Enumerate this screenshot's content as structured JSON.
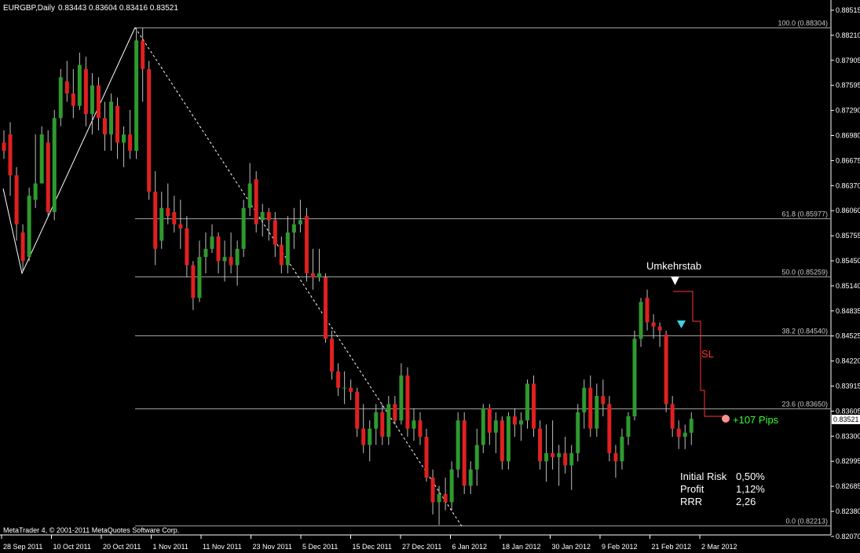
{
  "header": {
    "symbol": "EURGBP,Daily",
    "ohlc": "0.83443 0.83604 0.83416 0.83521"
  },
  "price_axis": {
    "ticks": [
      "0.88515",
      "0.88210",
      "0.87905",
      "0.87595",
      "0.87290",
      "0.86980",
      "0.86675",
      "0.86370",
      "0.86060",
      "0.85755",
      "0.85450",
      "0.85140",
      "0.84835",
      "0.84525",
      "0.84220",
      "0.83915",
      "0.83605",
      "0.83300",
      "0.82995",
      "0.82685",
      "0.82380",
      "0.82070"
    ],
    "current_price": "0.83521"
  },
  "time_axis": {
    "labels": [
      "28 Sep 2011",
      "10 Oct 2011",
      "20 Oct 2011",
      "1 Nov 2011",
      "11 Nov 2011",
      "23 Nov 2011",
      "5 Dec 2011",
      "15 Dec 2011",
      "27 Dec 2011",
      "6 Jan 2012",
      "18 Jan 2012",
      "30 Jan 2012",
      "9 Feb 2012",
      "21 Feb 2012",
      "2 Mar 2012"
    ]
  },
  "fibonacci": [
    {
      "label": "100.0 (0.88304)",
      "price": 0.88304
    },
    {
      "label": "61.8 (0.85977)",
      "price": 0.85977
    },
    {
      "label": "50.0 (0.85259)",
      "price": 0.85259
    },
    {
      "label": "38.2 (0.84540)",
      "price": 0.8454
    },
    {
      "label": "23.6 (0.83650)",
      "price": 0.8365
    },
    {
      "label": "0.0 (0.82213)",
      "price": 0.82213
    }
  ],
  "annotations": {
    "signal_label": "Umkehrstab",
    "sl_label": "SL",
    "profit_label": "+107 Pips"
  },
  "stats": [
    {
      "label": "Initial Risk",
      "value": "0,50%"
    },
    {
      "label": "Profit",
      "value": "1,12%"
    },
    {
      "label": "RRR",
      "value": "2,26"
    }
  ],
  "footer": {
    "copyright": "MetaTrader 4, © 2001-2011 MetaQuotes Software Corp."
  },
  "colors": {
    "background": "#000000",
    "bull": "#2e9a2e",
    "bear": "#e02020",
    "wick": "#c0c0c0",
    "fib_line": "#a0a0a0",
    "marker": "#ffffff",
    "entry_marker": "#40d0e0",
    "profit_marker": "#ff9090",
    "profit_text": "#33ff33",
    "sl": "#ff3333"
  },
  "chart_data": {
    "type": "candlestick",
    "symbol": "EURGBP",
    "timeframe": "Daily",
    "ylim": [
      0.8207,
      0.8852
    ],
    "candles": [
      {
        "o": 0.869,
        "h": 0.8705,
        "l": 0.867,
        "c": 0.868
      },
      {
        "o": 0.87,
        "h": 0.8715,
        "l": 0.8625,
        "c": 0.865
      },
      {
        "o": 0.865,
        "h": 0.866,
        "l": 0.857,
        "c": 0.859
      },
      {
        "o": 0.858,
        "h": 0.859,
        "l": 0.8532,
        "c": 0.8545
      },
      {
        "o": 0.855,
        "h": 0.8635,
        "l": 0.8545,
        "c": 0.8625
      },
      {
        "o": 0.862,
        "h": 0.87,
        "l": 0.861,
        "c": 0.864
      },
      {
        "o": 0.864,
        "h": 0.871,
        "l": 0.864,
        "c": 0.87
      },
      {
        "o": 0.869,
        "h": 0.8705,
        "l": 0.86,
        "c": 0.8605
      },
      {
        "o": 0.8605,
        "h": 0.873,
        "l": 0.8595,
        "c": 0.872
      },
      {
        "o": 0.872,
        "h": 0.878,
        "l": 0.871,
        "c": 0.877
      },
      {
        "o": 0.8765,
        "h": 0.879,
        "l": 0.874,
        "c": 0.875
      },
      {
        "o": 0.875,
        "h": 0.878,
        "l": 0.872,
        "c": 0.8735
      },
      {
        "o": 0.8735,
        "h": 0.88,
        "l": 0.873,
        "c": 0.8785
      },
      {
        "o": 0.878,
        "h": 0.8795,
        "l": 0.871,
        "c": 0.8725
      },
      {
        "o": 0.8725,
        "h": 0.8775,
        "l": 0.87,
        "c": 0.876
      },
      {
        "o": 0.876,
        "h": 0.877,
        "l": 0.8705,
        "c": 0.872
      },
      {
        "o": 0.872,
        "h": 0.874,
        "l": 0.868,
        "c": 0.87
      },
      {
        "o": 0.87,
        "h": 0.875,
        "l": 0.868,
        "c": 0.874
      },
      {
        "o": 0.8735,
        "h": 0.8745,
        "l": 0.867,
        "c": 0.869
      },
      {
        "o": 0.869,
        "h": 0.871,
        "l": 0.866,
        "c": 0.87
      },
      {
        "o": 0.87,
        "h": 0.873,
        "l": 0.867,
        "c": 0.868
      },
      {
        "o": 0.868,
        "h": 0.883,
        "l": 0.867,
        "c": 0.8815
      },
      {
        "o": 0.8815,
        "h": 0.883,
        "l": 0.874,
        "c": 0.878
      },
      {
        "o": 0.878,
        "h": 0.879,
        "l": 0.862,
        "c": 0.863
      },
      {
        "o": 0.863,
        "h": 0.8655,
        "l": 0.854,
        "c": 0.856
      },
      {
        "o": 0.857,
        "h": 0.863,
        "l": 0.856,
        "c": 0.861
      },
      {
        "o": 0.861,
        "h": 0.864,
        "l": 0.859,
        "c": 0.86
      },
      {
        "o": 0.8605,
        "h": 0.8625,
        "l": 0.858,
        "c": 0.859
      },
      {
        "o": 0.859,
        "h": 0.862,
        "l": 0.856,
        "c": 0.8585
      },
      {
        "o": 0.8585,
        "h": 0.86,
        "l": 0.8525,
        "c": 0.854
      },
      {
        "o": 0.854,
        "h": 0.8545,
        "l": 0.8485,
        "c": 0.85
      },
      {
        "o": 0.85,
        "h": 0.857,
        "l": 0.8495,
        "c": 0.855
      },
      {
        "o": 0.855,
        "h": 0.858,
        "l": 0.853,
        "c": 0.856
      },
      {
        "o": 0.856,
        "h": 0.859,
        "l": 0.8555,
        "c": 0.8575
      },
      {
        "o": 0.8575,
        "h": 0.858,
        "l": 0.853,
        "c": 0.8545
      },
      {
        "o": 0.8545,
        "h": 0.857,
        "l": 0.852,
        "c": 0.855
      },
      {
        "o": 0.855,
        "h": 0.858,
        "l": 0.853,
        "c": 0.854
      },
      {
        "o": 0.854,
        "h": 0.857,
        "l": 0.8515,
        "c": 0.856
      },
      {
        "o": 0.856,
        "h": 0.862,
        "l": 0.855,
        "c": 0.861
      },
      {
        "o": 0.861,
        "h": 0.8665,
        "l": 0.86,
        "c": 0.864
      },
      {
        "o": 0.8645,
        "h": 0.8655,
        "l": 0.858,
        "c": 0.859
      },
      {
        "o": 0.8595,
        "h": 0.8615,
        "l": 0.8575,
        "c": 0.8605
      },
      {
        "o": 0.8605,
        "h": 0.861,
        "l": 0.857,
        "c": 0.8595
      },
      {
        "o": 0.8595,
        "h": 0.8605,
        "l": 0.855,
        "c": 0.8565
      },
      {
        "o": 0.8565,
        "h": 0.8575,
        "l": 0.853,
        "c": 0.854
      },
      {
        "o": 0.854,
        "h": 0.86,
        "l": 0.853,
        "c": 0.858
      },
      {
        "o": 0.858,
        "h": 0.861,
        "l": 0.856,
        "c": 0.859
      },
      {
        "o": 0.859,
        "h": 0.862,
        "l": 0.858,
        "c": 0.8595
      },
      {
        "o": 0.86,
        "h": 0.861,
        "l": 0.852,
        "c": 0.853
      },
      {
        "o": 0.853,
        "h": 0.856,
        "l": 0.851,
        "c": 0.8525
      },
      {
        "o": 0.8525,
        "h": 0.856,
        "l": 0.852,
        "c": 0.853
      },
      {
        "o": 0.8525,
        "h": 0.853,
        "l": 0.8445,
        "c": 0.845
      },
      {
        "o": 0.845,
        "h": 0.846,
        "l": 0.84,
        "c": 0.841
      },
      {
        "o": 0.841,
        "h": 0.842,
        "l": 0.838,
        "c": 0.839
      },
      {
        "o": 0.839,
        "h": 0.841,
        "l": 0.837,
        "c": 0.839
      },
      {
        "o": 0.839,
        "h": 0.84,
        "l": 0.8375,
        "c": 0.8385
      },
      {
        "o": 0.8385,
        "h": 0.839,
        "l": 0.833,
        "c": 0.834
      },
      {
        "o": 0.834,
        "h": 0.837,
        "l": 0.831,
        "c": 0.832
      },
      {
        "o": 0.832,
        "h": 0.835,
        "l": 0.83,
        "c": 0.834
      },
      {
        "o": 0.834,
        "h": 0.837,
        "l": 0.832,
        "c": 0.836
      },
      {
        "o": 0.836,
        "h": 0.837,
        "l": 0.832,
        "c": 0.833
      },
      {
        "o": 0.833,
        "h": 0.838,
        "l": 0.832,
        "c": 0.837
      },
      {
        "o": 0.837,
        "h": 0.838,
        "l": 0.8345,
        "c": 0.835
      },
      {
        "o": 0.835,
        "h": 0.842,
        "l": 0.8345,
        "c": 0.8405
      },
      {
        "o": 0.8405,
        "h": 0.8415,
        "l": 0.833,
        "c": 0.834
      },
      {
        "o": 0.834,
        "h": 0.8365,
        "l": 0.8325,
        "c": 0.835
      },
      {
        "o": 0.835,
        "h": 0.836,
        "l": 0.832,
        "c": 0.833
      },
      {
        "o": 0.833,
        "h": 0.834,
        "l": 0.8275,
        "c": 0.828
      },
      {
        "o": 0.828,
        "h": 0.829,
        "l": 0.8235,
        "c": 0.825
      },
      {
        "o": 0.825,
        "h": 0.827,
        "l": 0.8222,
        "c": 0.826
      },
      {
        "o": 0.826,
        "h": 0.828,
        "l": 0.824,
        "c": 0.825
      },
      {
        "o": 0.825,
        "h": 0.83,
        "l": 0.824,
        "c": 0.829
      },
      {
        "o": 0.829,
        "h": 0.836,
        "l": 0.828,
        "c": 0.835
      },
      {
        "o": 0.835,
        "h": 0.836,
        "l": 0.826,
        "c": 0.827
      },
      {
        "o": 0.827,
        "h": 0.83,
        "l": 0.826,
        "c": 0.829
      },
      {
        "o": 0.829,
        "h": 0.834,
        "l": 0.827,
        "c": 0.832
      },
      {
        "o": 0.832,
        "h": 0.837,
        "l": 0.831,
        "c": 0.8365
      },
      {
        "o": 0.8365,
        "h": 0.837,
        "l": 0.832,
        "c": 0.8335
      },
      {
        "o": 0.8335,
        "h": 0.836,
        "l": 0.831,
        "c": 0.835
      },
      {
        "o": 0.835,
        "h": 0.8355,
        "l": 0.829,
        "c": 0.83
      },
      {
        "o": 0.83,
        "h": 0.836,
        "l": 0.829,
        "c": 0.8355
      },
      {
        "o": 0.8355,
        "h": 0.8365,
        "l": 0.833,
        "c": 0.8345
      },
      {
        "o": 0.8345,
        "h": 0.836,
        "l": 0.8325,
        "c": 0.835
      },
      {
        "o": 0.835,
        "h": 0.84,
        "l": 0.834,
        "c": 0.8395
      },
      {
        "o": 0.8395,
        "h": 0.8405,
        "l": 0.833,
        "c": 0.834
      },
      {
        "o": 0.834,
        "h": 0.835,
        "l": 0.829,
        "c": 0.83
      },
      {
        "o": 0.83,
        "h": 0.8345,
        "l": 0.8275,
        "c": 0.831
      },
      {
        "o": 0.831,
        "h": 0.835,
        "l": 0.829,
        "c": 0.8305
      },
      {
        "o": 0.8305,
        "h": 0.832,
        "l": 0.827,
        "c": 0.831
      },
      {
        "o": 0.831,
        "h": 0.833,
        "l": 0.8285,
        "c": 0.8295
      },
      {
        "o": 0.8295,
        "h": 0.832,
        "l": 0.8265,
        "c": 0.831
      },
      {
        "o": 0.831,
        "h": 0.837,
        "l": 0.83,
        "c": 0.836
      },
      {
        "o": 0.836,
        "h": 0.84,
        "l": 0.834,
        "c": 0.839
      },
      {
        "o": 0.839,
        "h": 0.8405,
        "l": 0.833,
        "c": 0.834
      },
      {
        "o": 0.834,
        "h": 0.8395,
        "l": 0.833,
        "c": 0.838
      },
      {
        "o": 0.838,
        "h": 0.84,
        "l": 0.8355,
        "c": 0.837
      },
      {
        "o": 0.837,
        "h": 0.838,
        "l": 0.83,
        "c": 0.831
      },
      {
        "o": 0.831,
        "h": 0.832,
        "l": 0.828,
        "c": 0.83
      },
      {
        "o": 0.83,
        "h": 0.834,
        "l": 0.829,
        "c": 0.833
      },
      {
        "o": 0.833,
        "h": 0.836,
        "l": 0.832,
        "c": 0.8355
      },
      {
        "o": 0.8355,
        "h": 0.846,
        "l": 0.835,
        "c": 0.845
      },
      {
        "o": 0.845,
        "h": 0.85,
        "l": 0.844,
        "c": 0.8495
      },
      {
        "o": 0.85,
        "h": 0.851,
        "l": 0.846,
        "c": 0.847
      },
      {
        "o": 0.847,
        "h": 0.848,
        "l": 0.845,
        "c": 0.8465
      },
      {
        "o": 0.8465,
        "h": 0.847,
        "l": 0.844,
        "c": 0.846
      },
      {
        "o": 0.8455,
        "h": 0.846,
        "l": 0.836,
        "c": 0.837
      },
      {
        "o": 0.837,
        "h": 0.838,
        "l": 0.833,
        "c": 0.834
      },
      {
        "o": 0.834,
        "h": 0.835,
        "l": 0.8315,
        "c": 0.833
      },
      {
        "o": 0.833,
        "h": 0.8345,
        "l": 0.8315,
        "c": 0.8335
      },
      {
        "o": 0.8335,
        "h": 0.836,
        "l": 0.832,
        "c": 0.8352
      }
    ]
  }
}
